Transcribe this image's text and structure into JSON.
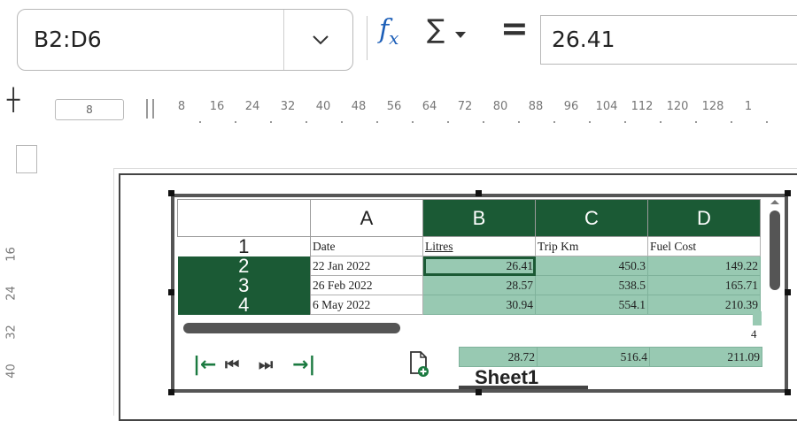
{
  "formula_bar": {
    "name_box": "B2:D6",
    "fx_label": "f",
    "fx_sub": "x",
    "sigma": "∑",
    "equals": "=",
    "formula_value": "26.41"
  },
  "ruler": {
    "indent_value": "8",
    "h_ticks": [
      "8",
      "16",
      "24",
      "32",
      "40",
      "48",
      "56",
      "64",
      "72",
      "80",
      "88",
      "96",
      "104",
      "112",
      "120",
      "128",
      "1"
    ],
    "v_ticks": [
      "16",
      "24",
      "32",
      "40"
    ]
  },
  "spreadsheet": {
    "columns": [
      "A",
      "B",
      "C",
      "D"
    ],
    "rows": [
      {
        "num": "1",
        "cells": [
          "Date",
          "Litres",
          "Trip Km",
          "Fuel Cost"
        ]
      },
      {
        "num": "2",
        "cells": [
          "22 Jan 2022",
          "26.41",
          "450.3",
          "149.22"
        ]
      },
      {
        "num": "3",
        "cells": [
          "26 Feb 2022",
          "28.57",
          "538.5",
          "165.71"
        ]
      },
      {
        "num": "4",
        "cells": [
          "6 May 2022",
          "30.94",
          "554.1",
          "210.39"
        ]
      }
    ],
    "last_row": [
      "28.72",
      "516.4",
      "211.09"
    ],
    "overflow_value": "4",
    "sheet_tab": "Sheet1",
    "colors": {
      "selection": "#1b5a35",
      "highlight": "#98c9b2",
      "nav": "#1b7a40"
    }
  },
  "icons": {
    "dropdown": "chevron-down-icon",
    "first_sheet": "first-sheet-icon",
    "prev_sheet": "previous-sheet-icon",
    "next_sheet": "next-sheet-icon",
    "last_sheet": "last-sheet-icon",
    "new_sheet": "new-sheet-icon"
  }
}
